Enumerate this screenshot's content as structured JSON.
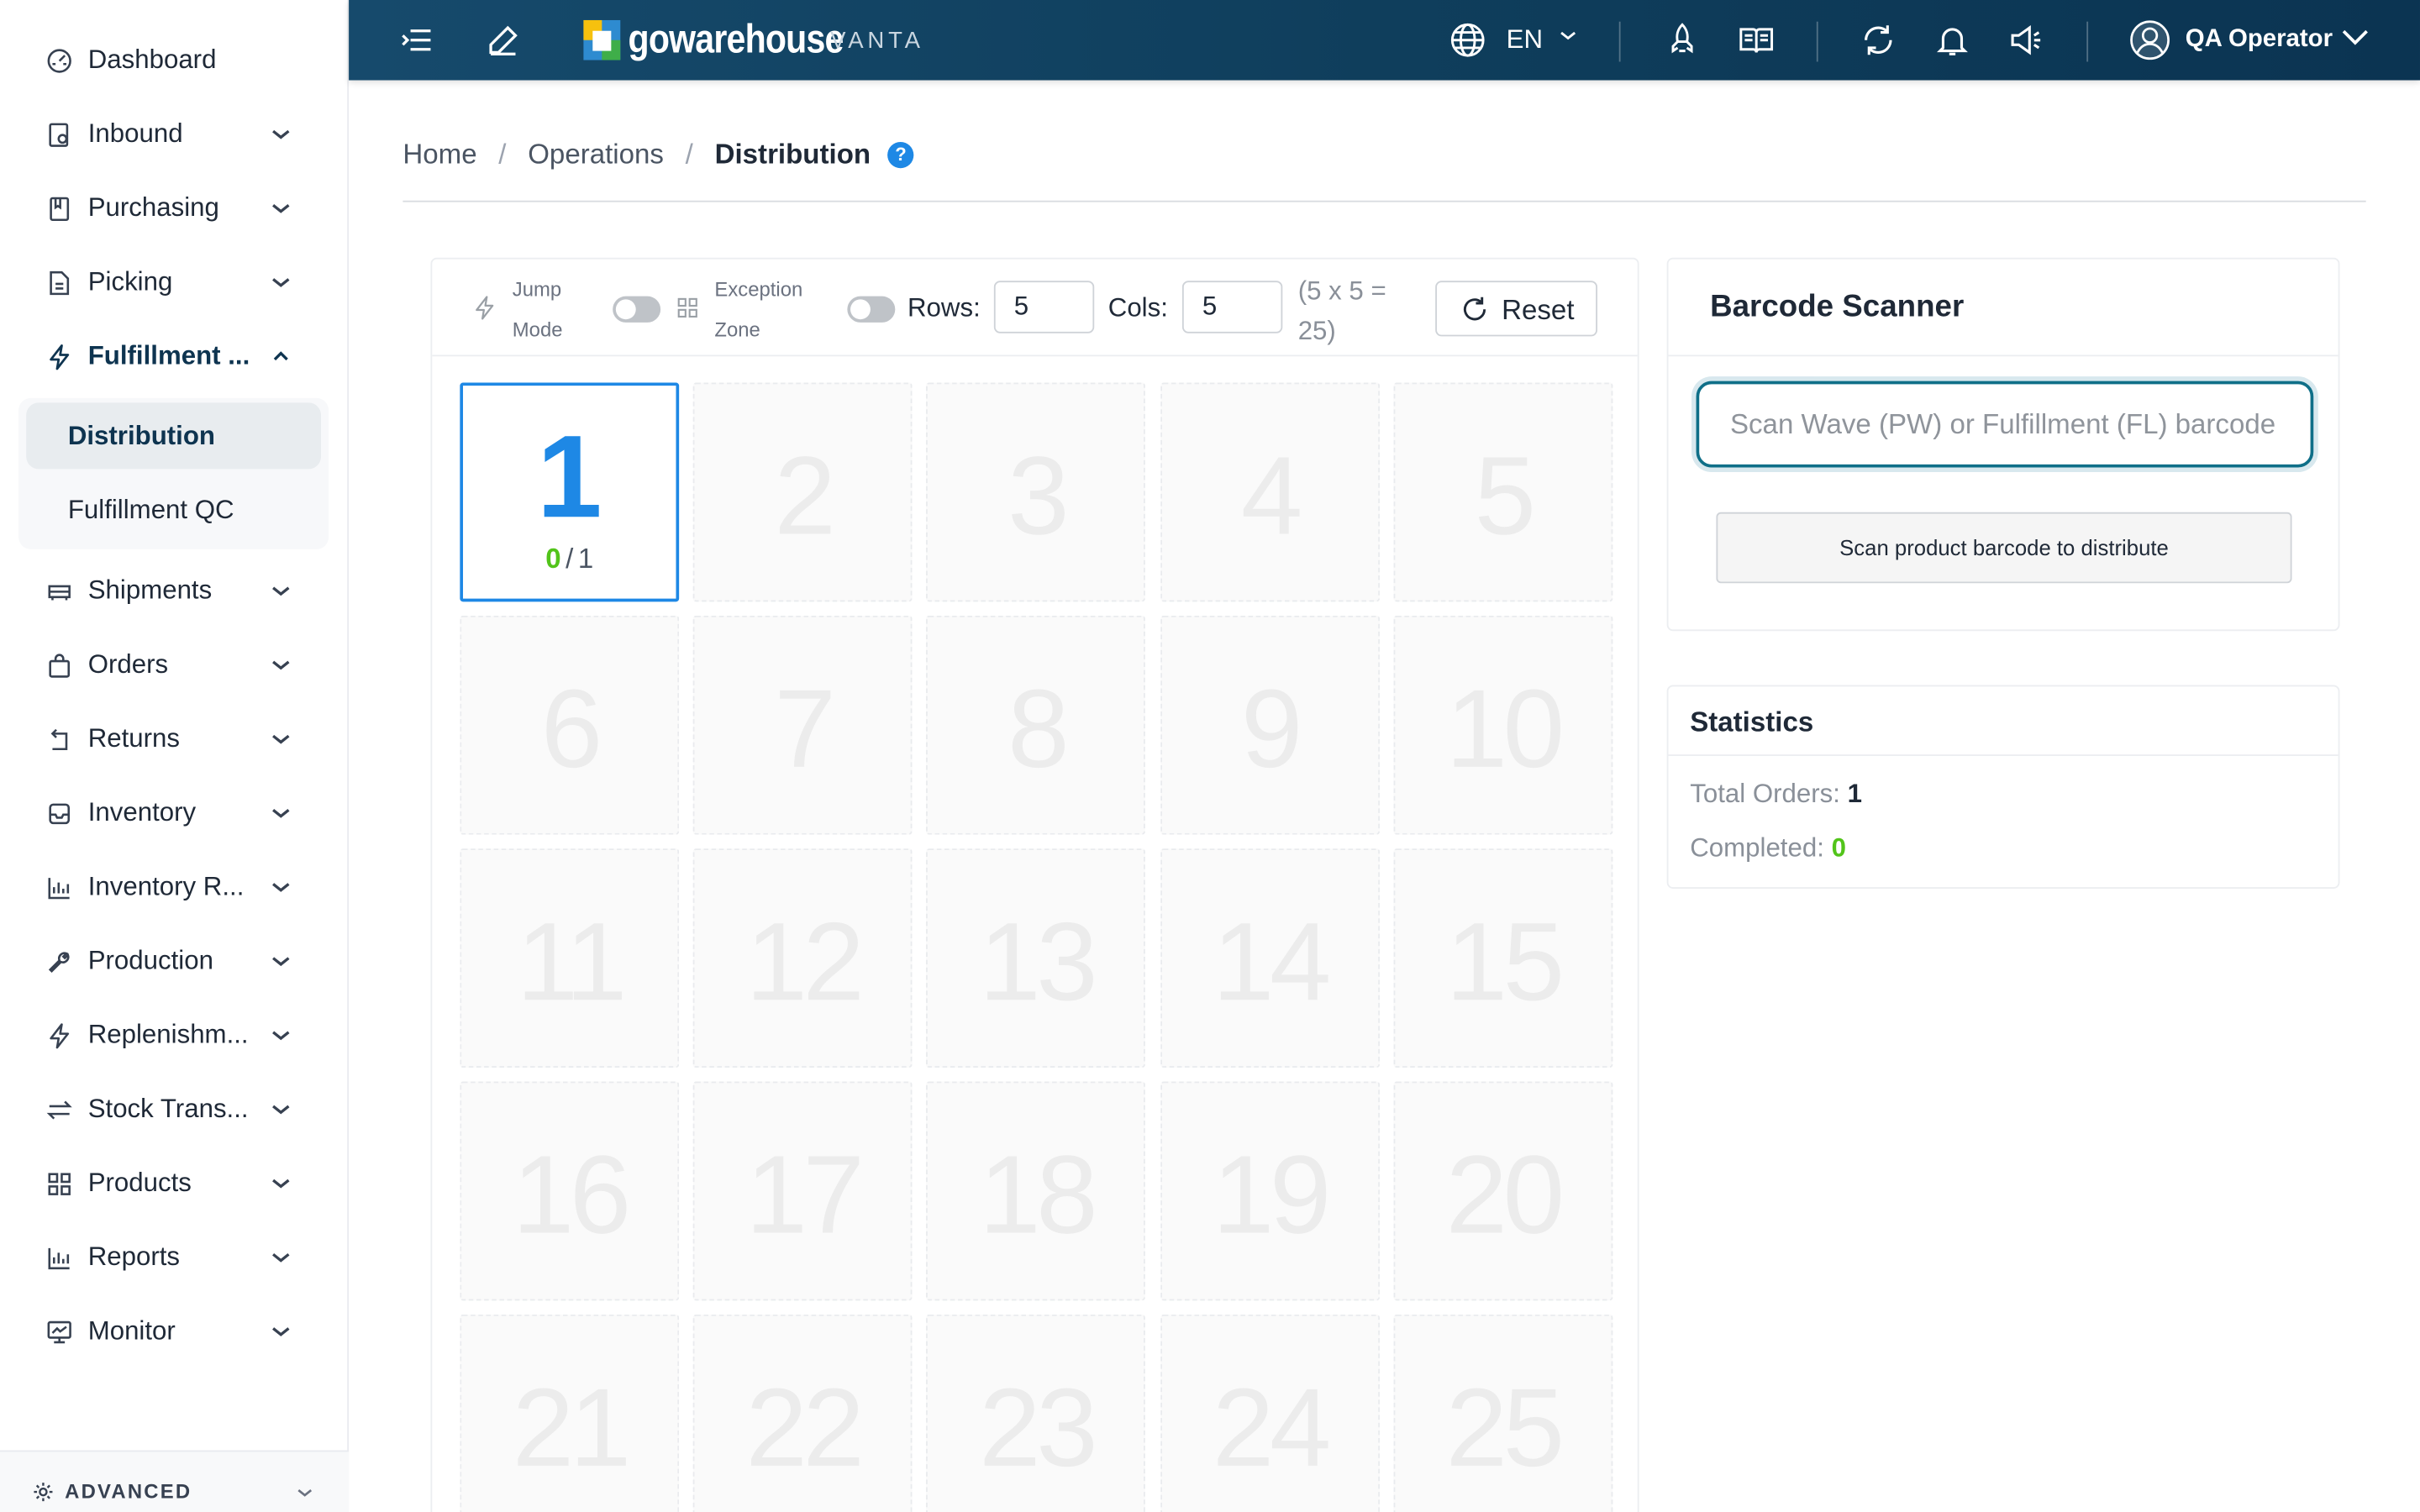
{
  "sidebar": {
    "items": [
      {
        "label": "Dashboard",
        "icon": "dashboard-icon",
        "has_chevron": false
      },
      {
        "label": "Inbound",
        "icon": "inbound-icon",
        "has_chevron": true
      },
      {
        "label": "Purchasing",
        "icon": "purchasing-icon",
        "has_chevron": true
      },
      {
        "label": "Picking",
        "icon": "picking-icon",
        "has_chevron": true
      },
      {
        "label": "Fulfillment ...",
        "icon": "lightning-icon",
        "has_chevron": true,
        "expanded": true
      },
      {
        "label": "Shipments",
        "icon": "truck-icon",
        "has_chevron": true
      },
      {
        "label": "Orders",
        "icon": "bag-icon",
        "has_chevron": true
      },
      {
        "label": "Returns",
        "icon": "return-icon",
        "has_chevron": true
      },
      {
        "label": "Inventory",
        "icon": "inbox-icon",
        "has_chevron": true
      },
      {
        "label": "Inventory R...",
        "icon": "bar-chart-icon",
        "has_chevron": true
      },
      {
        "label": "Production",
        "icon": "wrench-icon",
        "has_chevron": true
      },
      {
        "label": "Replenishm...",
        "icon": "lightning-icon",
        "has_chevron": true
      },
      {
        "label": "Stock Trans...",
        "icon": "transfer-icon",
        "has_chevron": true
      },
      {
        "label": "Products",
        "icon": "grid-icon",
        "has_chevron": true
      },
      {
        "label": "Reports",
        "icon": "bar-chart-icon",
        "has_chevron": true
      },
      {
        "label": "Monitor",
        "icon": "monitor-icon",
        "has_chevron": true
      }
    ],
    "submenu": [
      {
        "label": "Distribution",
        "selected": true
      },
      {
        "label": "Fulfillment QC",
        "selected": false
      }
    ],
    "advanced_label": "ADVANCED"
  },
  "header": {
    "brand": "gowarehouse",
    "brand_sub": "VANTA",
    "language": "EN",
    "user": "QA Operator",
    "icons": [
      "menu-toggle-icon",
      "edit-icon",
      "globe-icon",
      "rocket-icon",
      "book-icon",
      "refresh-icon",
      "bell-icon",
      "megaphone-icon",
      "user-avatar-icon"
    ]
  },
  "breadcrumb": {
    "home": "Home",
    "section": "Operations",
    "current": "Distribution",
    "help": "?"
  },
  "toolbar": {
    "jump_mode_line1": "Jump",
    "jump_mode_line2": "Mode",
    "jump_mode_on": false,
    "exception_zone_line1": "Exception",
    "exception_zone_line2": "Zone",
    "exception_zone_on": false,
    "rows_label": "Rows:",
    "rows_value": "5",
    "cols_label": "Cols:",
    "cols_value": "5",
    "formula_line1": "(5 x 5 =",
    "formula_line2": "25)",
    "reset_label": "Reset"
  },
  "grid": {
    "rows": 5,
    "cols": 5,
    "cells": [
      "1",
      "2",
      "3",
      "4",
      "5",
      "6",
      "7",
      "8",
      "9",
      "10",
      "11",
      "12",
      "13",
      "14",
      "15",
      "16",
      "17",
      "18",
      "19",
      "20",
      "21",
      "22",
      "23",
      "24",
      "25"
    ],
    "active_cell": "1",
    "active_done": "0",
    "active_sep": "/",
    "active_total": "1"
  },
  "scanner": {
    "title": "Barcode Scanner",
    "placeholder": "Scan Wave (PW) or Fulfillment (FL) barcode",
    "product_button": "Scan product barcode to distribute"
  },
  "stats": {
    "title": "Statistics",
    "total_label": "Total Orders:",
    "total_value": "1",
    "completed_label": "Completed:",
    "completed_value": "0"
  },
  "colors": {
    "header_bg": "#0f3e5c",
    "accent_blue": "#1e88e5",
    "success_green": "#52c41a",
    "input_focus": "#0f6f88"
  }
}
